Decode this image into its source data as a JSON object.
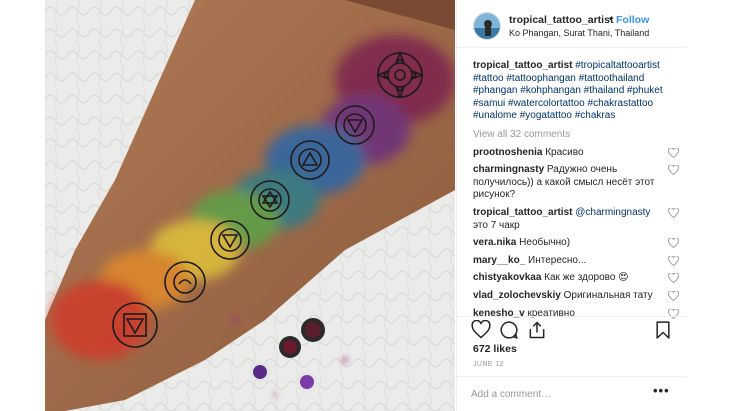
{
  "post": {
    "username": "tropical_tattoo_artist",
    "follow_label": "Follow",
    "location": "Ko Phangan, Surat Thani, Thailand",
    "caption_user": "tropical_tattoo_artist",
    "caption_lines": [
      "#tropicaltattooartist",
      "#tattoo #tattoophangan #tattoothailand",
      "#phangan #kohphangan #thailand #phuket",
      "#samui #watercolortattoo #chakrastattoo",
      "#unalome #yogatattoo #chakras"
    ],
    "view_all": "View all 32 comments",
    "likes": "672 likes",
    "date": "JUNE 12",
    "add_comment_placeholder": "Add a comment…",
    "more_label": "•••"
  },
  "comments": [
    {
      "user": "prootnoshenia",
      "mention": "",
      "text": "Красиво"
    },
    {
      "user": "charmingnasty",
      "mention": "",
      "text": "Радужно очень получилось)) а какой смысл несёт этот рисунок?"
    },
    {
      "user": "tropical_tattoo_artist",
      "mention": "@charmingnasty",
      "text": "это 7 чакр"
    },
    {
      "user": "vera.nika",
      "mention": "",
      "text": "Необычно)"
    },
    {
      "user": "mary__ko_",
      "mention": "",
      "text": "Интересно..."
    },
    {
      "user": "chistyakovkaa",
      "mention": "",
      "text": "Как же здорово 😍"
    },
    {
      "user": "vlad_zolochevskiy",
      "mention": "",
      "text": "Оригинальная тату"
    },
    {
      "user": "kenesho_v",
      "mention": "",
      "text": "креативно"
    }
  ],
  "icons": {
    "like": "heart-icon",
    "comment": "comment-icon",
    "share": "share-icon",
    "save": "bookmark-icon"
  },
  "colors": {
    "follow": "#3897f0",
    "hashtag": "#003569",
    "muted": "#999999"
  }
}
